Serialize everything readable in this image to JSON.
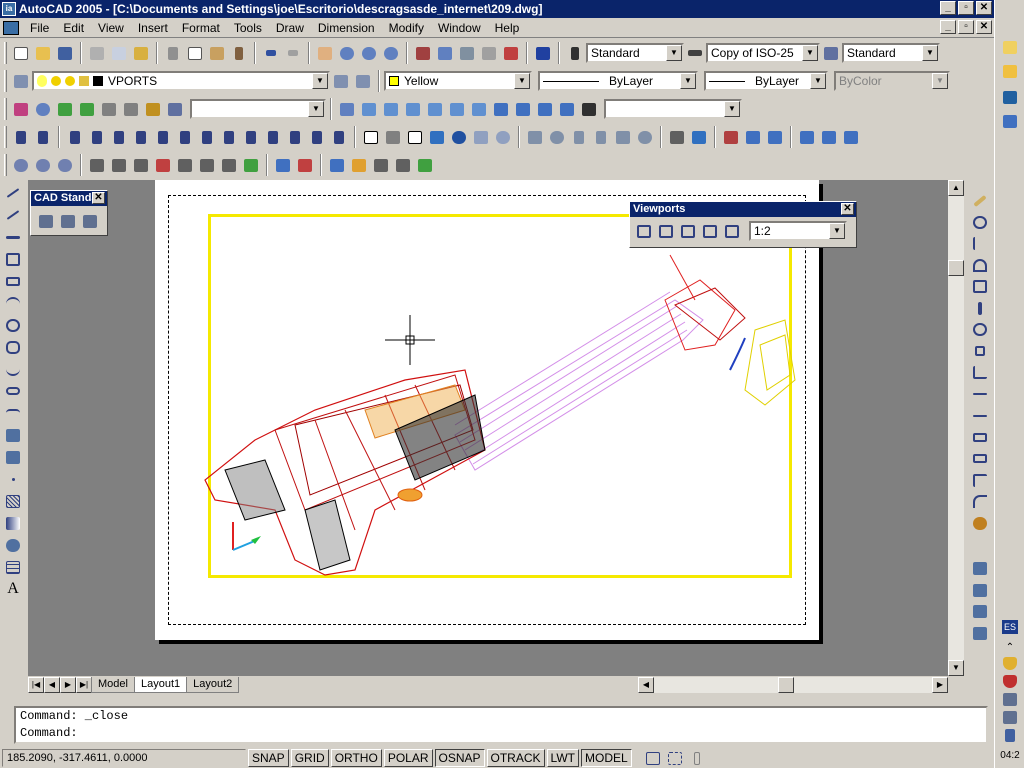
{
  "window": {
    "title": "AutoCAD 2005 - [C:\\Documents and Settings\\joe\\Escritorio\\descragsasde_internet\\209.dwg]",
    "app_icon_label": "ia",
    "minimize": "_",
    "restore": "▫",
    "close": "✕"
  },
  "menu": [
    "File",
    "Edit",
    "View",
    "Insert",
    "Format",
    "Tools",
    "Draw",
    "Dimension",
    "Modify",
    "Window",
    "Help"
  ],
  "toolbars": {
    "text_style": "Standard",
    "dim_style": "Copy of ISO-25",
    "table_style": "Standard",
    "layer": "VPORTS",
    "color": "Yellow",
    "linetype": "ByLayer",
    "lineweight": "ByLayer",
    "plotstyle": "ByColor",
    "view_combo": "",
    "ucs_combo": "",
    "colors": {
      "layer_swatch": "#000000",
      "yellow_swatch": "#ffff00"
    }
  },
  "cad_standards": {
    "title": "CAD Standa",
    "close": "✕"
  },
  "viewports": {
    "title": "Viewports",
    "scale": "1:2",
    "close": "✕"
  },
  "tabs": [
    "Model",
    "Layout1",
    "Layout2"
  ],
  "active_tab": "Layout1",
  "command": {
    "line1": "Command: _close",
    "line2": "Command:"
  },
  "status": {
    "coords": "185.2090, -317.4611, 0.0000",
    "toggles": [
      "SNAP",
      "GRID",
      "ORTHO",
      "POLAR",
      "OSNAP",
      "OTRACK",
      "LWT",
      "MODEL"
    ],
    "active_toggles": [
      "OSNAP",
      "MODEL"
    ]
  },
  "system_tray": {
    "lang": "ES",
    "clock": "04:2"
  }
}
